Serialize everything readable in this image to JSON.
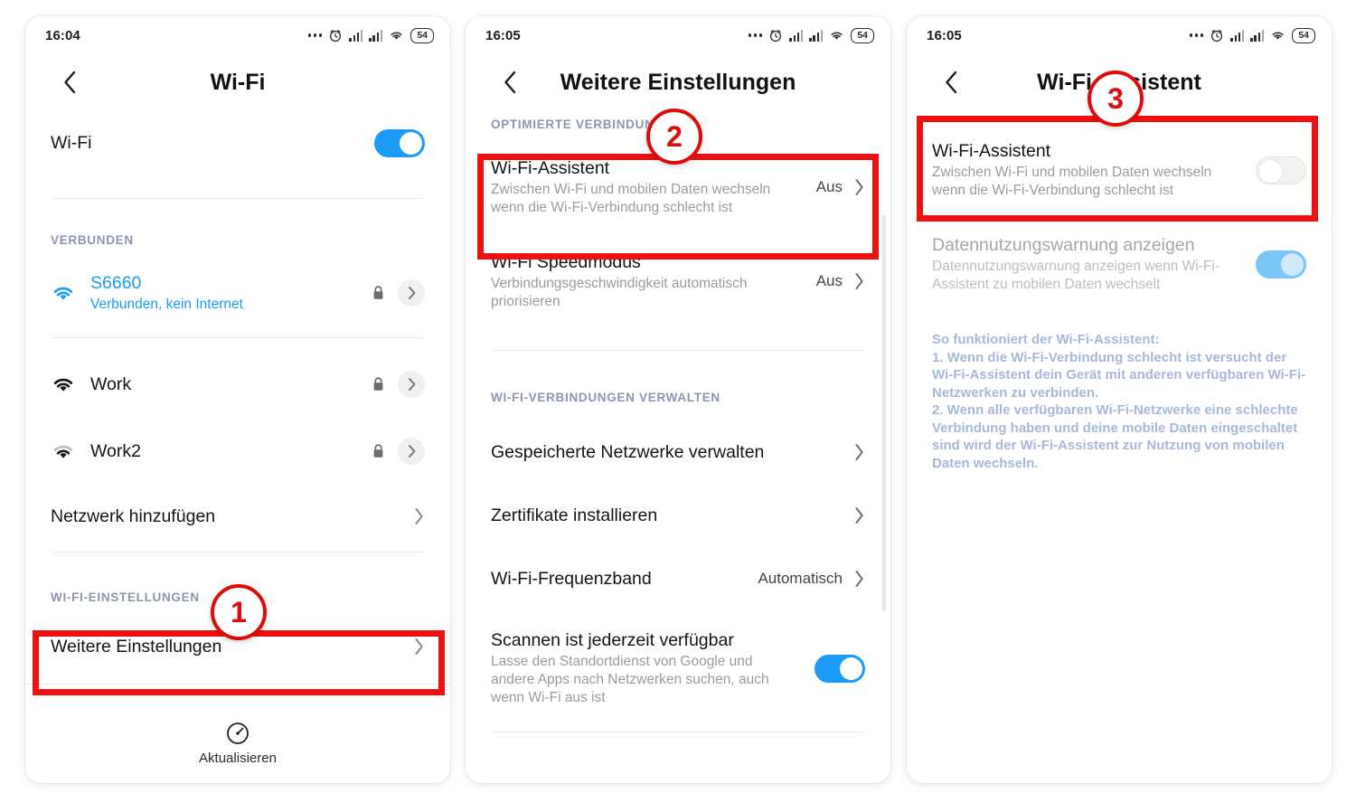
{
  "panels": [
    {
      "status": {
        "time": "16:04",
        "battery": "54"
      },
      "appbar": {
        "title": "Wi-Fi"
      },
      "wifi_toggle_row": {
        "label": "Wi-Fi",
        "state": "on"
      },
      "connected_header": "VERBUNDEN",
      "networks": [
        {
          "ssid": "S6660",
          "sub": "Verbunden, kein Internet",
          "secured": true,
          "connected": true
        },
        {
          "ssid": "Work",
          "sub": "",
          "secured": true,
          "connected": false
        },
        {
          "ssid": "Work2",
          "sub": "",
          "secured": true,
          "connected": false
        }
      ],
      "add_network": "Netzwerk hinzufügen",
      "settings_header": "WI-FI-EINSTELLUNGEN",
      "more_settings": "Weitere Einstellungen",
      "refresh": "Aktualisieren"
    },
    {
      "status": {
        "time": "16:05",
        "battery": "54"
      },
      "appbar": {
        "title": "Weitere Einstellungen"
      },
      "section1_header": "OPTIMIERTE VERBINDUNGEN",
      "items1": [
        {
          "title": "Wi-Fi-Assistent",
          "sub": "Zwischen Wi-Fi und mobilen Daten wechseln wenn die Wi-Fi-Verbindung schlecht ist",
          "value": "Aus"
        },
        {
          "title": "Wi-Fi Speedmodus",
          "sub": "Verbindungsgeschwindigkeit automatisch priorisieren",
          "value": "Aus"
        }
      ],
      "section2_header": "WI-FI-VERBINDUNGEN VERWALTEN",
      "items2": [
        {
          "title": "Gespeicherte Netzwerke verwalten",
          "value": ""
        },
        {
          "title": "Zertifikate installieren",
          "value": ""
        },
        {
          "title": "Wi-Fi-Frequenzband",
          "value": "Automatisch"
        }
      ],
      "scan_item": {
        "title": "Scannen ist jederzeit verfügbar",
        "sub": "Lasse den Standortdienst von Google und andere Apps nach Netzwerken suchen, auch wenn Wi-Fi aus ist",
        "state": "on"
      }
    },
    {
      "status": {
        "time": "16:05",
        "battery": "54"
      },
      "appbar": {
        "title": "Wi-Fi-Assistent"
      },
      "assistant_row": {
        "title": "Wi-Fi-Assistent",
        "sub": "Zwischen Wi-Fi und mobilen Daten wechseln wenn die Wi-Fi-Verbindung schlecht ist",
        "state": "off"
      },
      "warning_row": {
        "title": "Datennutzungswarnung anzeigen",
        "sub": "Datennutzungswarnung anzeigen wenn Wi-Fi-Assistent zu mobilen Daten wechselt",
        "state": "on-dimmed"
      },
      "info": {
        "heading": "So funktioniert der Wi-Fi-Assistent:",
        "line1": "1. Wenn die Wi-Fi-Verbindung schlecht ist versucht der Wi-Fi-Assistent dein Gerät mit anderen verfügbaren Wi-Fi-Netzwerken zu verbinden.",
        "line2": "2. Wenn alle verfügbaren Wi-Fi-Netzwerke eine schlechte Verbindung haben und deine mobile Daten eingeschaltet sind wird der Wi-Fi-Assistent zur Nutzung von mobilen Daten wechseln."
      }
    }
  ],
  "annotations": {
    "badge1": "1",
    "badge2": "2",
    "badge3": "3",
    "highlight_color": "#ee1111"
  }
}
